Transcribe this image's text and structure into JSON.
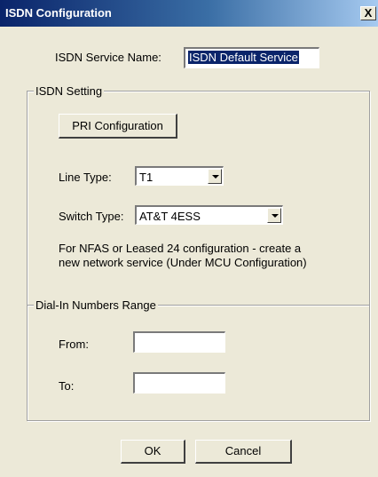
{
  "window": {
    "title": "ISDN Configuration",
    "close_label": "X"
  },
  "service": {
    "label": "ISDN Service Name:",
    "value": "ISDN Default Service"
  },
  "isdn_setting": {
    "legend": "ISDN Setting",
    "pri_button": "PRI Configuration",
    "line_type": {
      "label": "Line Type:",
      "value": "T1"
    },
    "switch_type": {
      "label": "Switch Type:",
      "value": "AT&T 4ESS"
    },
    "note": [
      "For NFAS or Leased 24 configuration - create a",
      "new network service (Under MCU Configuration)"
    ]
  },
  "dial_in": {
    "legend": "Dial-In Numbers Range",
    "from_label": "From:",
    "from_value": "",
    "to_label": "To:",
    "to_value": ""
  },
  "buttons": {
    "ok": "OK",
    "cancel": "Cancel"
  }
}
